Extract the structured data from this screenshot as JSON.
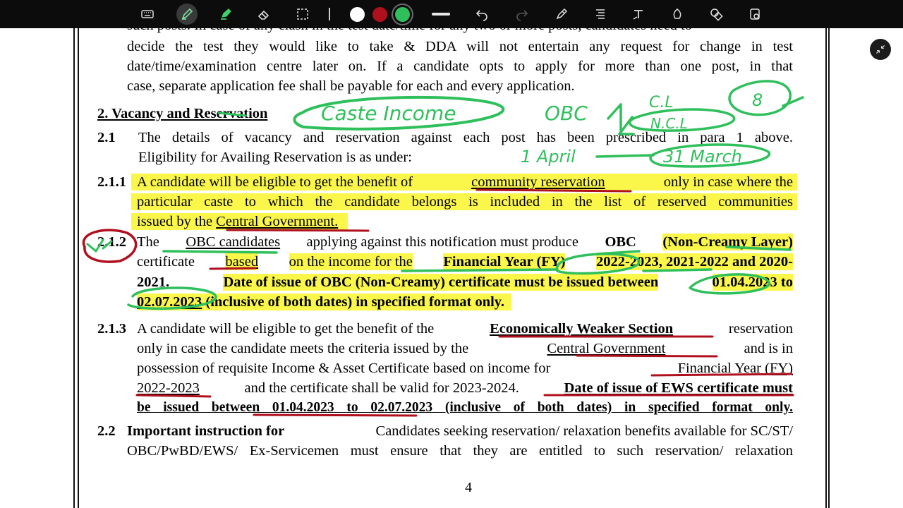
{
  "toolbar": {
    "tools": [
      "keyboard-icon",
      "pen-icon",
      "highlighter-icon",
      "eraser-icon",
      "lasso-select-icon"
    ],
    "colors": {
      "white": "#ffffff",
      "red": "#b0101e",
      "green": "#2fbf5b"
    },
    "actions": [
      "undo-icon",
      "redo-icon",
      "pen-settings-icon",
      "text-format-icon",
      "text-tool-icon",
      "shape-icon",
      "shapes-icon",
      "sticker-icon"
    ]
  },
  "doc": {
    "line_top_cut": "such posts. In case of any clash in the test date/time for any two or more posts, candidates need to",
    "p_intro_l1": "decide the test they would like to take & DDA will not entertain any request for change in test",
    "p_intro_l2": "date/time/examination centre later on. If a candidate opts to apply for more than one post, in that",
    "p_intro_l3": "case, separate application fee shall be payable for each and every application.",
    "section_heading": "2. Vacancy and Reservation",
    "s21_num": "2.1",
    "s21_l1": "The details of vacancy and reservation against each post has been prescribed in para 1 above.",
    "s21_l2": "Eligibility for Availing Reservation is as under:",
    "s211_num": "2.1.1",
    "s211_l1a": "A candidate will be eligible to get the benefit of",
    "s211_l1b": "community reservation",
    "s211_l1c": "only in case where the",
    "s211_l2": "particular caste to which the candidate belongs is included in the list of reserved communities",
    "s211_l3a": "issued by the",
    "s211_l3b": "Central Government.",
    "s212_num": "2.1.2",
    "s212_l1a": "The",
    "s212_l1b": "OBC candidates",
    "s212_l1c": "applying against this notification must produce",
    "s212_l1d": "OBC",
    "s212_l1e": "(Non-Creamy Layer)",
    "s212_l2a": "certificate",
    "s212_l2b": "based",
    "s212_l2c": "on the income for the",
    "s212_l2d": "Financial Year (FY)",
    "s212_l2e": "2022-2023, 2021-2022 and 2020-",
    "s212_l3a": "2021.",
    "s212_l3b": "Date of issue of OBC (Non-Creamy) certificate must be issued between",
    "s212_l3c": "01.04.2023 to",
    "s212_l4a": "02.07.2023",
    "s212_l4b": "(inclusive of both dates) in specified format only.",
    "s213_num": "2.1.3",
    "s213_l1a": "A candidate will be eligible to get the benefit of the",
    "s213_l1b": "Economically Weaker Section",
    "s213_l1c": "reservation",
    "s213_l2a": "only in case the candidate meets the criteria issued by the",
    "s213_l2b": "Central Government",
    "s213_l2c": "and is in",
    "s213_l3a": "possession of requisite Income & Asset Certificate based on income for",
    "s213_l3b": "Financial Year (FY)",
    "s213_l4a": "2022-2023",
    "s213_l4b": "and the certificate shall be valid for 2023-2024.",
    "s213_l4c": "Date of issue of EWS certificate must",
    "s213_l5": "be issued between 01.04.2023 to 02.07.2023 (inclusive of both dates) in specified format only.",
    "s22_num": "2.2",
    "s22_l1a": "Important instruction for",
    "s22_l1b": "Candidates seeking reservation/ relaxation benefits available for SC/ST/",
    "s22_l2": "OBC/PwBD/EWS/ Ex-Servicemen must ensure that they are entitled to such reservation/ relaxation",
    "page_number": "4"
  },
  "annotations": {
    "ink_colors": {
      "green": "#2fbf5b",
      "red": "#b0101e"
    },
    "note_caste_income": "Caste Income",
    "note_obc": "OBC",
    "note_cl": "C.L",
    "note_ncl": "N.C.L",
    "note_circle": "8",
    "note_april": "1 April",
    "note_march": "31 March"
  }
}
